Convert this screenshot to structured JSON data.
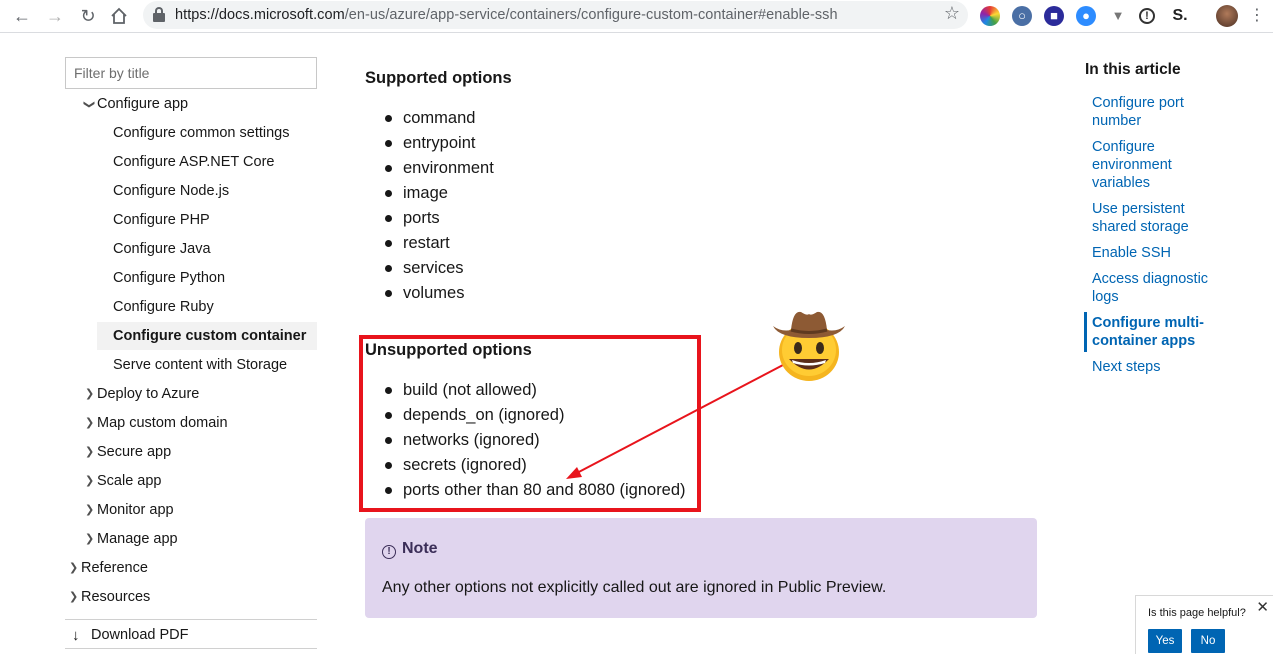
{
  "browser": {
    "url_host": "https://docs.microsoft.com",
    "url_path": "/en-us/azure/app-service/containers/configure-custom-container#enable-ssh",
    "ext_label": "S."
  },
  "sidebar": {
    "filter_placeholder": "Filter by title",
    "items": [
      {
        "label": "Configure app"
      },
      {
        "label": "Configure common settings"
      },
      {
        "label": "Configure ASP.NET Core"
      },
      {
        "label": "Configure Node.js"
      },
      {
        "label": "Configure PHP"
      },
      {
        "label": "Configure Java"
      },
      {
        "label": "Configure Python"
      },
      {
        "label": "Configure Ruby"
      },
      {
        "label": "Configure custom container"
      },
      {
        "label": "Serve content with Storage"
      },
      {
        "label": "Deploy to Azure"
      },
      {
        "label": "Map custom domain"
      },
      {
        "label": "Secure app"
      },
      {
        "label": "Scale app"
      },
      {
        "label": "Monitor app"
      },
      {
        "label": "Manage app"
      },
      {
        "label": "Reference"
      },
      {
        "label": "Resources"
      }
    ],
    "download_pdf": "Download PDF"
  },
  "main": {
    "supported_heading": "Supported options",
    "supported": [
      "command",
      "entrypoint",
      "environment",
      "image",
      "ports",
      "restart",
      "services",
      "volumes"
    ],
    "unsupported_heading": "Unsupported options",
    "unsupported": [
      "build (not allowed)",
      "depends_on (ignored)",
      "networks (ignored)",
      "secrets (ignored)",
      "ports other than 80 and 8080 (ignored)"
    ],
    "note_title": "Note",
    "note_body": "Any other options not explicitly called out are ignored in Public Preview."
  },
  "toc": {
    "heading": "In this article",
    "links": [
      "Configure port number",
      "Configure environment variables",
      "Use persistent shared storage",
      "Enable SSH",
      "Access diagnostic logs",
      "Configure multi-container apps",
      "Next steps"
    ]
  },
  "feedback": {
    "question": "Is this page helpful?",
    "yes": "Yes",
    "no": "No"
  },
  "colors": {
    "link": "#0065b3",
    "highlight_box": "#e8141c",
    "note_bg": "#e0d5ee"
  }
}
